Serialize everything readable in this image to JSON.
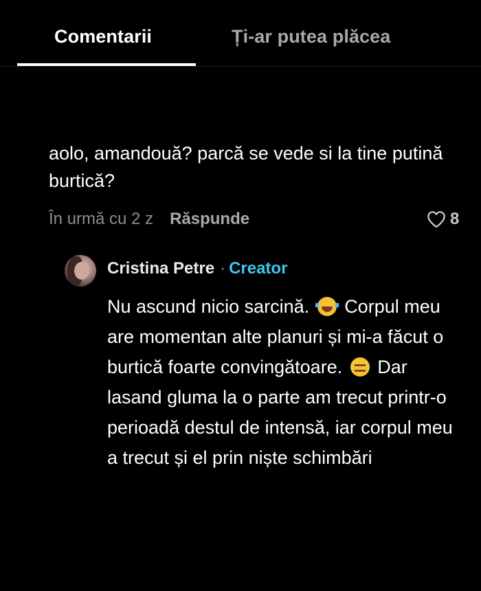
{
  "tabs": {
    "comments": "Comentarii",
    "suggested": "Ți-ar putea plăcea",
    "active": "comments"
  },
  "comment": {
    "text": "aolo, amandouă? parcă se vede si la tine putină burtică?",
    "time": "În urmă cu 2 z",
    "reply_label": "Răspunde",
    "likes": "8"
  },
  "reply": {
    "author": "Cristina Petre",
    "separator": "·",
    "badge": "Creator",
    "text_part1": "Nu ascund nicio sarcină.",
    "emoji1": "face-with-tears-of-joy",
    "text_part2": "Corpul meu are momentan alte planuri și mi-a făcut o burtică foarte convingătoare.",
    "emoji2": "expressionless-face",
    "text_part3": "Dar lasand gluma la o parte am trecut printr-o perioadă destul de intensă, iar corpul meu a trecut și el prin niște schimbări"
  },
  "colors": {
    "background": "#000000",
    "text": "#ffffff",
    "muted": "#a9a9ab",
    "creator_badge": "#3ec9f0"
  }
}
